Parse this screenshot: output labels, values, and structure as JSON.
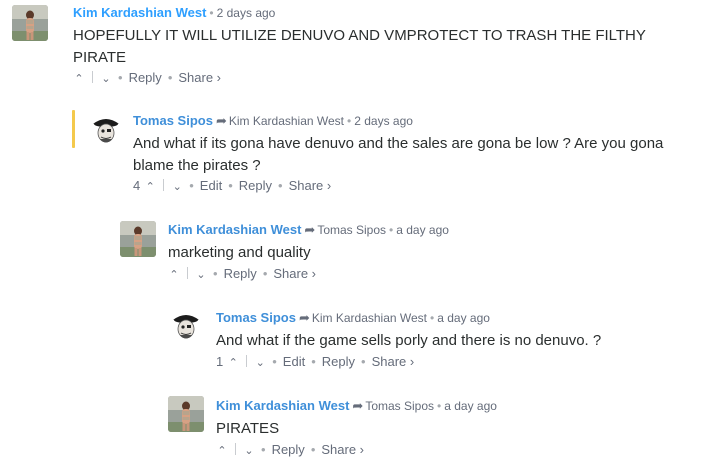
{
  "comments": [
    {
      "author": "Kim Kardashian West",
      "parent": "",
      "time": "2 days ago",
      "text": "HOPEFULLY IT WILL UTILIZE DENUVO AND VMPROTECT TO TRASH THE FILTHY PIRATE",
      "votes": "",
      "reply_label": "Reply",
      "share_label": "Share ›",
      "edit_label": "",
      "avatar": "kim-avatar"
    },
    {
      "author": "Tomas Sipos",
      "parent": "Kim Kardashian West",
      "time": "2 days ago",
      "text": "And what if its gona have denuvo and the sales are gona be low ? Are you gona blame the pirates ?",
      "votes": "4",
      "reply_label": "Reply",
      "share_label": "Share ›",
      "edit_label": "Edit",
      "avatar": "pirate-avatar"
    },
    {
      "author": "Kim Kardashian West",
      "parent": "Tomas Sipos",
      "time": "a day ago",
      "text": "marketing and quality",
      "votes": "",
      "reply_label": "Reply",
      "share_label": "Share ›",
      "edit_label": "",
      "avatar": "kim-avatar"
    },
    {
      "author": "Tomas Sipos",
      "parent": "Kim Kardashian West",
      "time": "a day ago",
      "text": "And what if the game sells porly and there is no denuvo. ?",
      "votes": "1",
      "reply_label": "Reply",
      "share_label": "Share ›",
      "edit_label": "Edit",
      "avatar": "pirate-avatar"
    },
    {
      "author": "Kim Kardashian West",
      "parent": "Tomas Sipos",
      "time": "a day ago",
      "text": "PIRATES",
      "votes": "",
      "reply_label": "Reply",
      "share_label": "Share ›",
      "edit_label": "",
      "avatar": "kim-avatar"
    }
  ],
  "icons": {
    "upvote": "^",
    "downvote": "v",
    "reply_arrow": "➦",
    "separator_dot": "•"
  },
  "colors": {
    "author_link": "#2e9fff",
    "meta_gray": "#656c7a",
    "highlight_bar": "#f4c94c"
  }
}
